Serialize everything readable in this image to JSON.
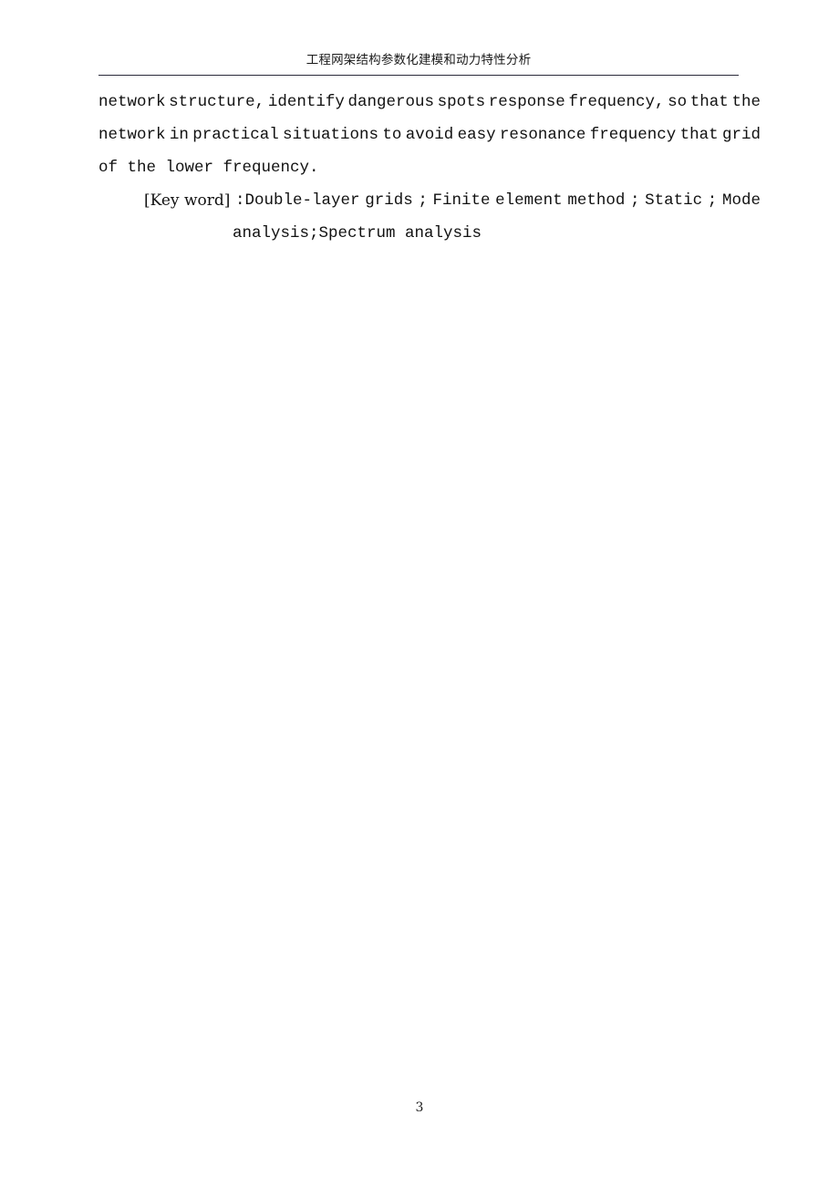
{
  "document": {
    "page_number": "3",
    "text_color": "#111111",
    "background_color": "#ffffff",
    "rule_color": "#2b2b3a"
  },
  "header": {
    "title": "工程网架结构参数化建模和动力特性分析"
  },
  "body": {
    "paragraph_lines": [
      {
        "words": [
          "network",
          "structure,",
          "identify",
          "dangerous",
          "spots",
          "response",
          "frequency,",
          "so",
          "that",
          "the"
        ],
        "justified": true
      },
      {
        "words": [
          "network",
          "in",
          "practical",
          "situations",
          "to",
          "avoid",
          "easy",
          "resonance",
          "frequency",
          "that",
          "grid"
        ],
        "justified": true
      },
      {
        "text": "of the lower frequency.",
        "justified": false
      }
    ]
  },
  "keywords": {
    "label": "[Key word]",
    "line_1_words": [
      ":Double-layer",
      "grids",
      ";",
      "Finite",
      "element",
      "method",
      ";",
      "Static",
      ";",
      "Mode"
    ],
    "line_2": "analysis;Spectrum analysis",
    "full_text": "[Key word]:Double-layer grids ; Finite element method ; Static ; Mode analysis;Spectrum analysis"
  }
}
